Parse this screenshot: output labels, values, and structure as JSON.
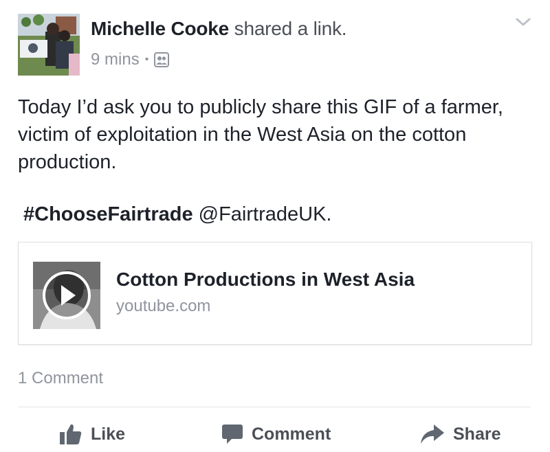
{
  "post": {
    "author": "Michelle Cooke",
    "action": "shared a link.",
    "time": "9 mins",
    "separator": "•",
    "privacy_icon": "friends-icon",
    "menu_icon": "chevron-down-icon",
    "text": "Today I’d ask you to publicly share this GIF of a farmer, victim of exploitation in the West Asia on the cotton production.",
    "hashtag": "#ChooseFairtrade",
    "mention": "@FairtradeUK."
  },
  "link_card": {
    "title": "Cotton Productions in West Asia",
    "domain": "youtube.com",
    "thumb_icon": "play-icon"
  },
  "footer": {
    "comment_count": "1 Comment",
    "actions": [
      {
        "label": "Like",
        "icon": "thumbs-up-icon"
      },
      {
        "label": "Comment",
        "icon": "speech-bubble-icon"
      },
      {
        "label": "Share",
        "icon": "share-arrow-icon"
      }
    ]
  },
  "colors": {
    "text_primary": "#1d2129",
    "text_secondary": "#90949c",
    "action_text": "#4b4f56",
    "border": "#dddfe2"
  }
}
